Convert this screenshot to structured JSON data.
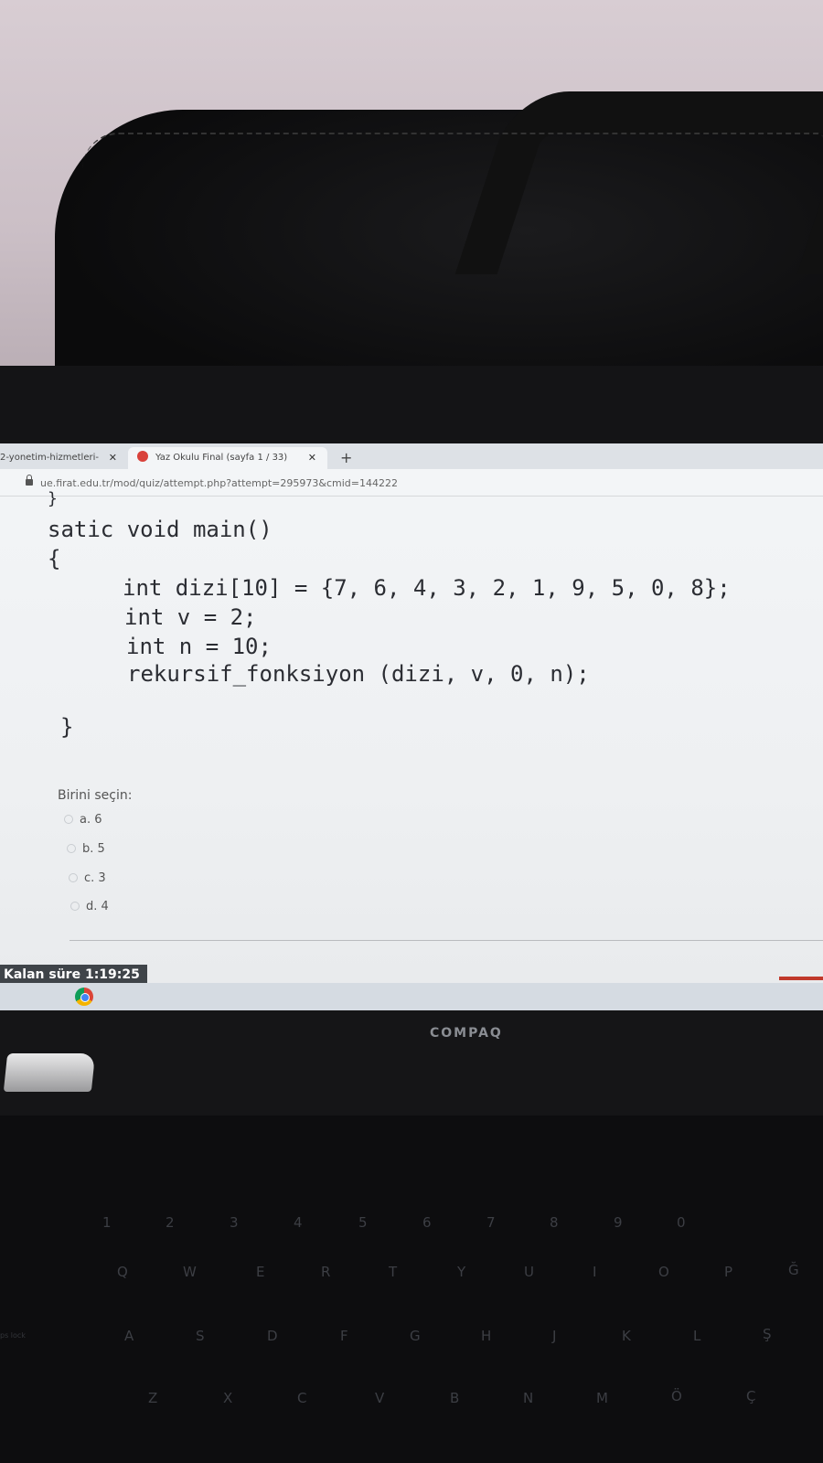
{
  "browser": {
    "tabs": [
      {
        "title": "2-yonetim-hizmetleri-"
      },
      {
        "title": "Yaz Okulu Final (sayfa 1 / 33)"
      }
    ],
    "url": "ue.firat.edu.tr/mod/quiz/attempt.php?attempt=295973&cmid=144222"
  },
  "code_lines": [
    "}",
    "satic void main()",
    "{",
    "int dizi[10] = {7, 6, 4, 3, 2, 1, 9, 5, 0, 8};",
    "int v = 2;",
    "int n = 10;",
    "rekursif_fonksiyon (dizi, v, 0, n);",
    "}"
  ],
  "question": {
    "prompt": "Birini seçin:",
    "options": [
      "a. 6",
      "b. 5",
      "c. 3",
      "d. 4"
    ]
  },
  "timer": "Kalan süre 1:19:25",
  "laptop": {
    "brand": "COMPAQ",
    "keys": {
      "row_q": [
        "Q",
        "W",
        "E",
        "R",
        "T",
        "Y",
        "U",
        "I",
        "O",
        "P",
        "Ğ"
      ],
      "row_a": [
        "A",
        "S",
        "D",
        "F",
        "G",
        "H",
        "J",
        "K",
        "L",
        "Ş"
      ],
      "row_z": [
        "Z",
        "X",
        "C",
        "V",
        "B",
        "N",
        "M",
        "Ö",
        "Ç"
      ],
      "row_num": [
        "1",
        "2",
        "3",
        "4",
        "5",
        "6",
        "7",
        "8",
        "9",
        "0"
      ],
      "caps": "ps lock"
    }
  },
  "colors": {
    "timer_bg": "#3f4449",
    "favicon": "#d9413a"
  }
}
